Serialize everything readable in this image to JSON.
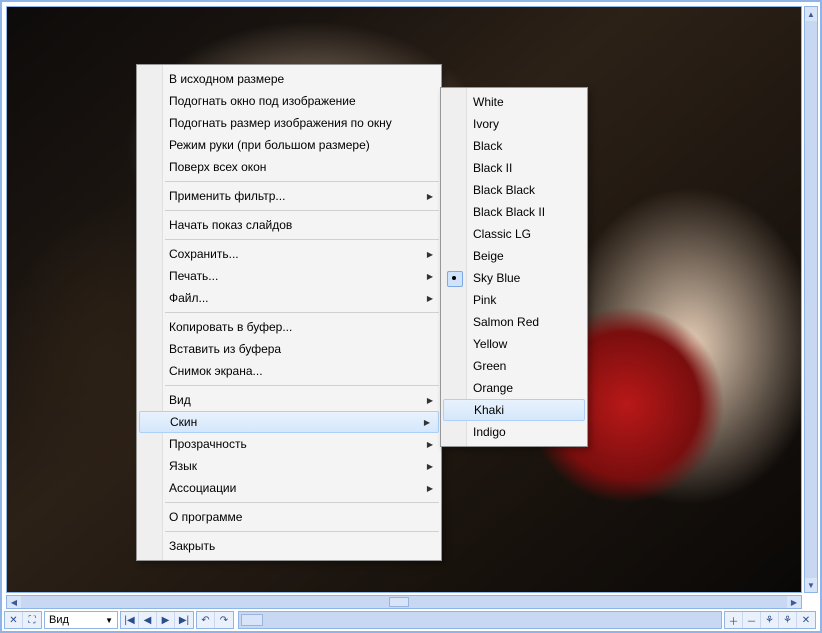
{
  "toolbar": {
    "view_dropdown_label": "Вид",
    "buttons_left": [
      "close-icon",
      "fit-icon"
    ],
    "nav_buttons": [
      "first-icon",
      "prev-icon",
      "next-icon",
      "last-icon"
    ],
    "rotate_buttons": [
      "rotate-left-icon",
      "rotate-right-icon"
    ],
    "right_buttons": [
      "zoom-in-icon",
      "zoom-out-icon",
      "tool-a-icon",
      "tool-b-icon",
      "close-small-icon"
    ]
  },
  "context_menu": {
    "groups": [
      [
        "В исходном размере",
        "Подогнать окно под изображение",
        "Подогнать размер изображения по окну",
        "Режим руки (при большом размере)",
        "Поверх всех окон"
      ],
      [
        {
          "label": "Применить фильтр...",
          "sub": true
        }
      ],
      [
        "Начать показ слайдов"
      ],
      [
        {
          "label": "Сохранить...",
          "sub": true
        },
        {
          "label": "Печать...",
          "sub": true
        },
        {
          "label": "Файл...",
          "sub": true
        }
      ],
      [
        "Копировать в буфер...",
        "Вставить из буфера",
        "Снимок экрана..."
      ],
      [
        {
          "label": "Вид",
          "sub": true
        },
        {
          "label": "Скин",
          "sub": true,
          "hl": true
        },
        {
          "label": "Прозрачность",
          "sub": true
        },
        {
          "label": "Язык",
          "sub": true
        },
        {
          "label": "Ассоциации",
          "sub": true
        }
      ],
      [
        "О программе"
      ],
      [
        "Закрыть"
      ]
    ]
  },
  "skin_submenu": {
    "items": [
      {
        "label": "White"
      },
      {
        "label": "Ivory"
      },
      {
        "label": "Black"
      },
      {
        "label": "Black II"
      },
      {
        "label": "Black Black"
      },
      {
        "label": "Black Black II"
      },
      {
        "label": "Classic LG"
      },
      {
        "label": "Beige"
      },
      {
        "label": "Sky Blue",
        "checked": true
      },
      {
        "label": "Pink"
      },
      {
        "label": "Salmon Red"
      },
      {
        "label": "Yellow"
      },
      {
        "label": "Green"
      },
      {
        "label": "Orange"
      },
      {
        "label": "Khaki",
        "hl": true
      },
      {
        "label": "Indigo"
      }
    ]
  }
}
